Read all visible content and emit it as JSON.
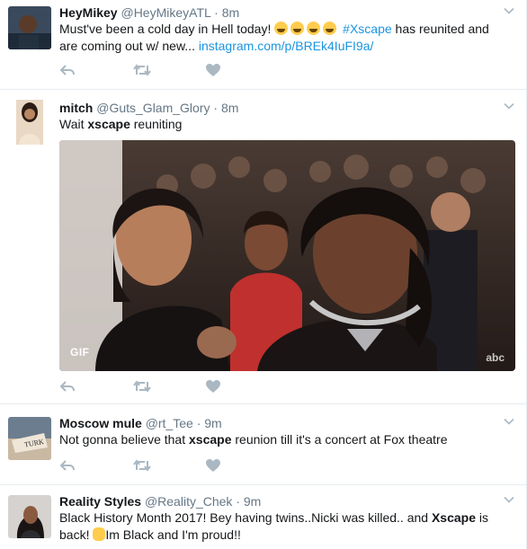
{
  "colors": {
    "link": "#1b95e0",
    "text": "#14171a",
    "meta": "#657786",
    "icon": "#aab8c2",
    "divider": "#e6ecf0"
  },
  "tweets": [
    {
      "name": "HeyMikey",
      "handle": "@HeyMikeyATL",
      "dot": "·",
      "time": "8m",
      "text_parts": {
        "p1": "Must've been a cold day in Hell today!",
        "emoji": "😂😂😂😂",
        "hashtag": "#Xscape",
        "p2": " has reunited and are coming out w/ new...",
        "link": "instagram.com/p/BREk4IuFI9a/"
      }
    },
    {
      "name": "mitch",
      "handle": "@Guts_Glam_Glory",
      "dot": "·",
      "time": "8m",
      "text_parts": {
        "p1": "Wait ",
        "bold": "xscape",
        "p2": " reuniting"
      },
      "media": {
        "badge": "GIF",
        "watermark": "abc"
      }
    },
    {
      "name": "Moscow mule",
      "handle": "@rt_Tee",
      "dot": "·",
      "time": "9m",
      "text_parts": {
        "p1": "Not gonna believe that ",
        "bold": "xscape",
        "p2": " reunion till it's a concert at Fox theatre"
      },
      "avatar_text": "TURK"
    },
    {
      "name": "Reality Styles",
      "handle": "@Reality_Chek",
      "dot": "·",
      "time": "9m",
      "text_parts": {
        "p1": "Black History Month 2017! Bey having twins..Nicki was killed.. and ",
        "bold": "Xscape",
        "p2": " is back! ",
        "emoji": "✊",
        "p3": "Im Black and I'm proud!!"
      }
    }
  ],
  "icons": {
    "reply": "reply-icon",
    "retweet": "retweet-icon",
    "like": "heart-icon",
    "caret": "chevron-down-icon"
  }
}
